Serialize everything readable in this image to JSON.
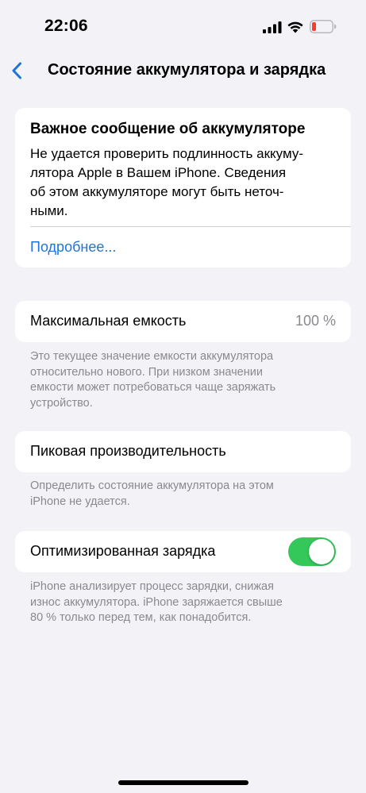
{
  "status_bar": {
    "time": "22:06",
    "battery_color": "#ff3b30"
  },
  "nav": {
    "back_icon": "chevron-left-icon",
    "title": "Состояние аккумулятора и зарядка"
  },
  "alert": {
    "title": "Важное сообщение об аккумуляторе",
    "lines": [
      "Не удается проверить подлинность аккуму-",
      "лятора Apple в Вашем iPhone. Сведения",
      "об этом аккумуляторе могут быть неточ-",
      "ными."
    ],
    "link": "Подробнее..."
  },
  "max_capacity": {
    "label": "Максимальная емкость",
    "value": "100 %",
    "footnote": [
      "Это текущее значение емкости аккумулятора",
      "относительно нового. При низком значении",
      "емкости может потребоваться чаще заряжать",
      "устройство."
    ]
  },
  "peak_performance": {
    "label": "Пиковая производительность",
    "footnote": [
      "Определить состояние аккумулятора на этом",
      "iPhone не удается."
    ]
  },
  "optimized_charging": {
    "label": "Оптимизированная зарядка",
    "enabled": true,
    "toggle_color": "#34c759",
    "footnote": [
      "iPhone анализирует процесс зарядки, снижая",
      "износ аккумулятора. iPhone заряжается свыше",
      "80 % только перед тем, как понадобится."
    ]
  },
  "colors": {
    "background": "#f2f2f7",
    "accent": "#1f73d9",
    "secondary_text": "#8a8a8e"
  }
}
